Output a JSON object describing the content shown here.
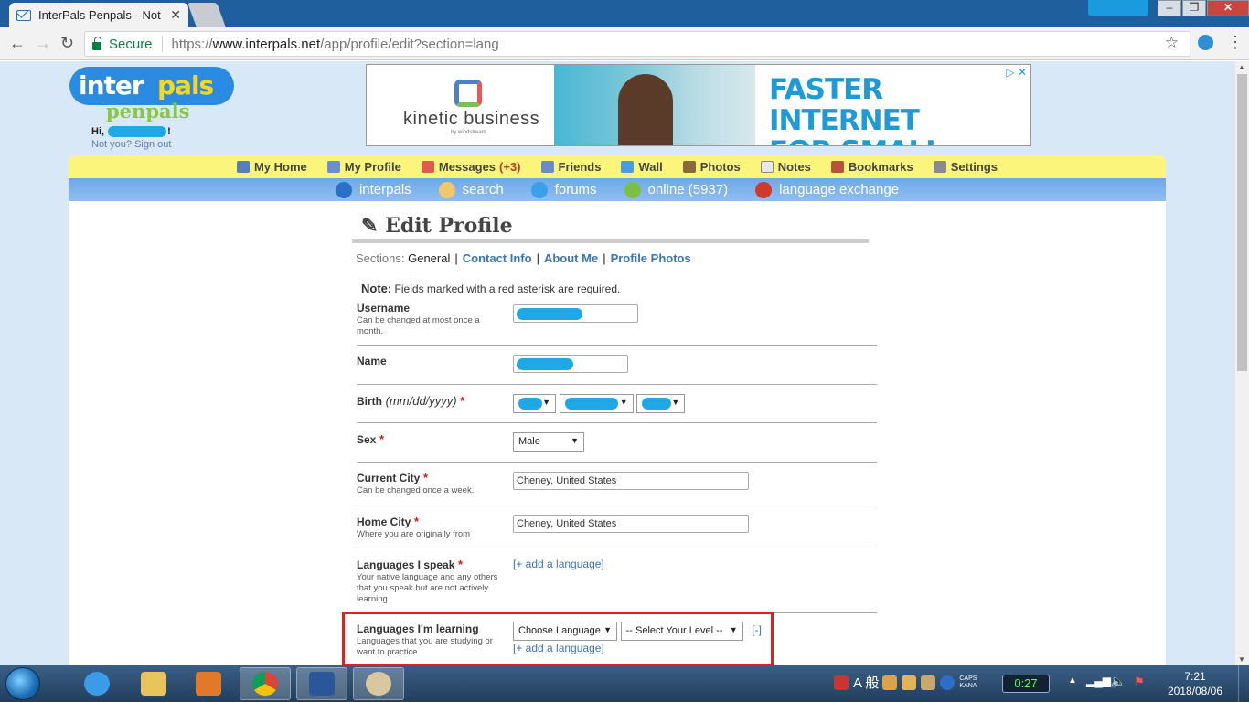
{
  "browser": {
    "tab_title": "InterPals Penpals - Not",
    "secure_label": "Secure",
    "url_scheme": "https://",
    "url_host": "www.interpals.net",
    "url_path": "/app/profile/edit?section=lang"
  },
  "site": {
    "logo_inter": "inter",
    "logo_pals": "pals",
    "logo_penpals": "penpals",
    "greeting_prefix": "Hi,",
    "greeting_suffix": "!",
    "signout_text": "Not you? Sign out"
  },
  "ad": {
    "brand": "kinetic business",
    "brand_sub": "by windstream",
    "headline_line1": "FASTER INTERNET",
    "headline_line2": "FOR SMALL BUSINESS"
  },
  "main_nav": [
    {
      "label": "My Home",
      "icon": "home-icon",
      "color": "#5b7db5"
    },
    {
      "label": "My Profile",
      "icon": "profile-icon",
      "color": "#6a8fc9"
    },
    {
      "label": "Messages",
      "count": "(+3)",
      "icon": "envelope-icon",
      "color": "#e05a4e"
    },
    {
      "label": "Friends",
      "icon": "friends-icon",
      "color": "#6c8dc4"
    },
    {
      "label": "Wall",
      "icon": "wall-icon",
      "color": "#4a9be0"
    },
    {
      "label": "Photos",
      "icon": "photos-icon",
      "color": "#8a6a3a"
    },
    {
      "label": "Notes",
      "icon": "notes-icon",
      "color": "#e8e8e8"
    },
    {
      "label": "Bookmarks",
      "icon": "bookmarks-icon",
      "color": "#b5543a"
    },
    {
      "label": "Settings",
      "icon": "settings-icon",
      "color": "#8a8a8a"
    }
  ],
  "sub_nav": [
    {
      "label": "interpals",
      "icon": "globe-icon",
      "color": "#2c6fc8"
    },
    {
      "label": "search",
      "icon": "search-icon",
      "color": "#f2c86b"
    },
    {
      "label": "forums",
      "icon": "speech-bubble-icon",
      "color": "#3aa0ea"
    },
    {
      "label": "online (5937)",
      "icon": "online-users-icon",
      "color": "#7bc043"
    },
    {
      "label": "language exchange",
      "icon": "flag-icon",
      "color": "#d0392b"
    }
  ],
  "page": {
    "title": "Edit Profile",
    "sections_label": "Sections:",
    "section_current": "General",
    "section_links": [
      "Contact Info",
      "About Me",
      "Profile Photos"
    ],
    "note_bold": "Note:",
    "note_text": " Fields marked with a red asterisk are required."
  },
  "form": {
    "username": {
      "label": "Username",
      "hint": "Can be changed at most once a month."
    },
    "name": {
      "label": "Name"
    },
    "birth": {
      "label": "Birth",
      "format": "(mm/dd/yyyy)",
      "required": "*"
    },
    "sex": {
      "label": "Sex",
      "required": "*",
      "value": "Male"
    },
    "current_city": {
      "label": "Current City",
      "required": "*",
      "hint": "Can be changed once a week.",
      "value": "Cheney, United States"
    },
    "home_city": {
      "label": "Home City",
      "required": "*",
      "hint": "Where you are originally from",
      "value": "Cheney, United States"
    },
    "languages_speak": {
      "label": "Languages I speak",
      "required": "*",
      "hint": "Your native language and any others that you speak but are not actively learning",
      "add_link": "[+ add a language]"
    },
    "languages_learning": {
      "label": "Languages I'm learning",
      "hint": "Languages that you are studying or want to practice",
      "choose_language": "Choose Language",
      "select_level": "-- Select Your Level --",
      "remove_link": "[-]",
      "add_link": "[+ add a language]"
    }
  },
  "taskbar": {
    "ime_text": "A 般",
    "caps_top": "CAPS",
    "caps_bottom": "KANA",
    "timer": "0:27",
    "time": "7:21",
    "date": "2018/08/06"
  }
}
